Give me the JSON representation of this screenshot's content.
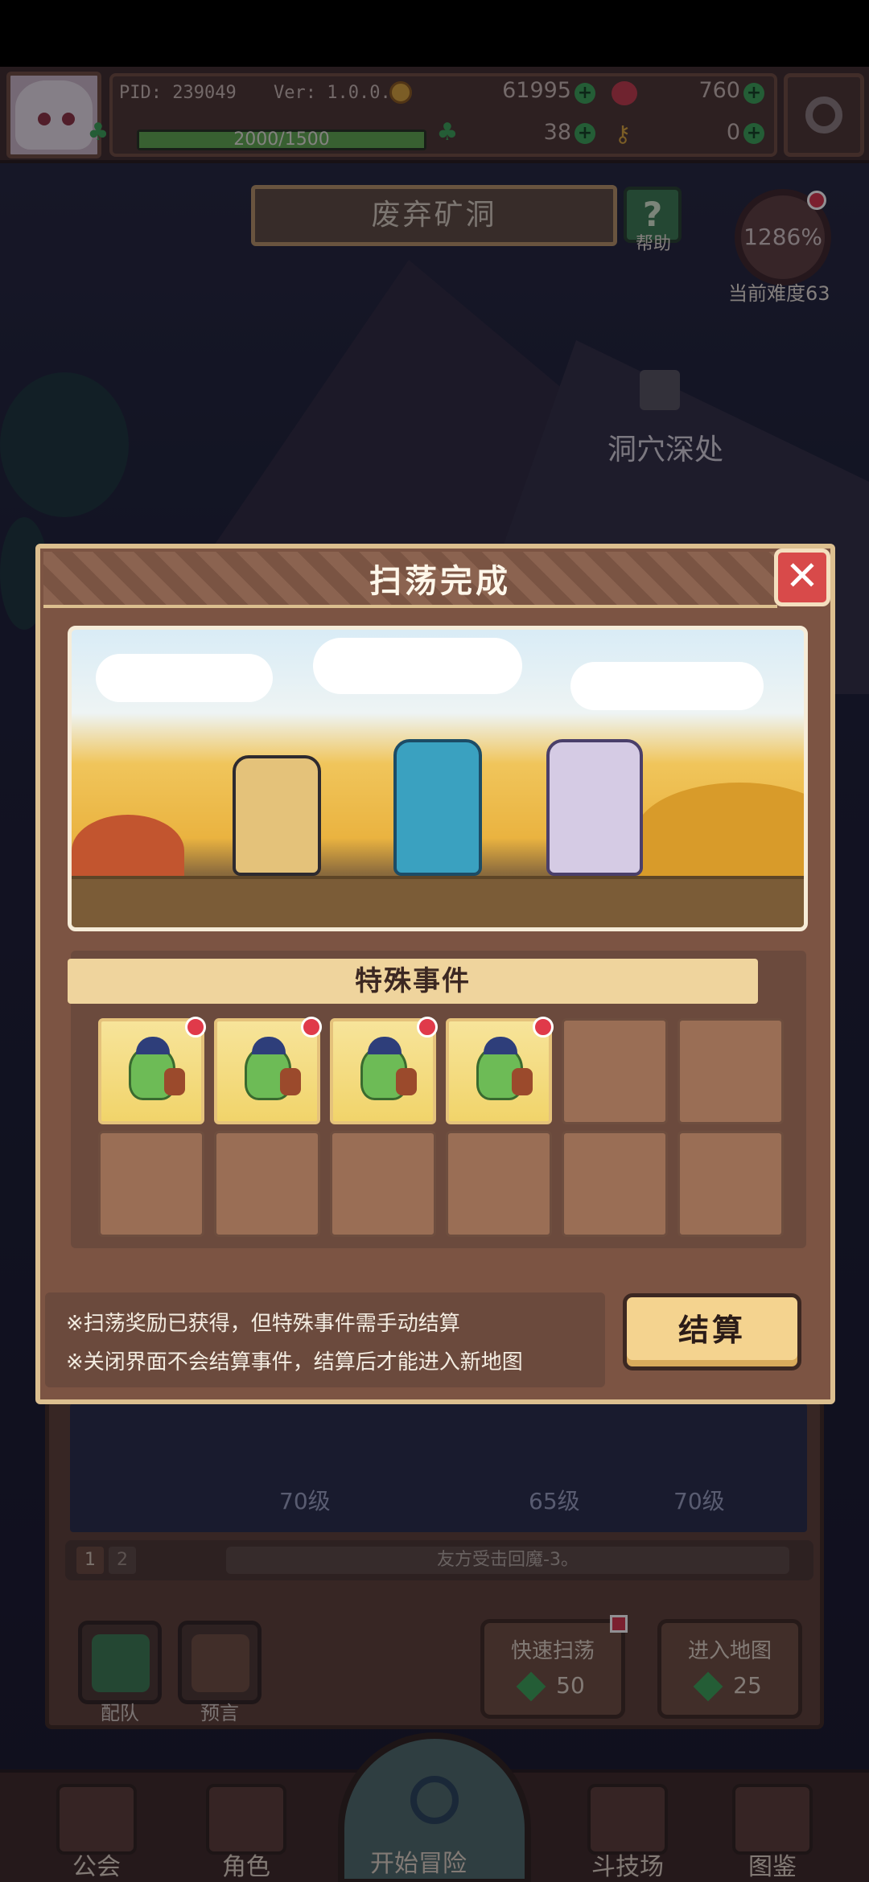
{
  "hud": {
    "pid": "PID: 239049",
    "version": "Ver: 1.0.0.8",
    "gold": "61995",
    "apples": "760",
    "exp": "2000/1500",
    "exp_fraction": 1.0,
    "clovers": "38",
    "keys": "0"
  },
  "map": {
    "name": "废弃矿洞",
    "help_label": "帮助",
    "difficulty_percent": "1286%",
    "difficulty_label": "当前难度63",
    "locked_area": "洞穴深处"
  },
  "modal": {
    "title": "扫荡完成",
    "close_symbol": "✕",
    "events_header": "特殊事件",
    "event_slots_filled": 4,
    "event_slots_total": 12,
    "note1": "※扫荡奖励已获得，但特殊事件需手动结算",
    "note2": "※关闭界面不会结算事件，结算后才能进入新地图",
    "settle_label": "结算"
  },
  "lower": {
    "lvl1": "70级",
    "lvl2": "65级",
    "lvl3": "70级",
    "page1": "1",
    "page2": "2",
    "log": "友方受击回魔-3。",
    "team_label": "配队",
    "prophecy_label": "预言",
    "quick_sweep_label": "快速扫荡",
    "quick_sweep_cost": "50",
    "enter_map_label": "进入地图",
    "enter_map_cost": "25"
  },
  "nav": {
    "guild": "公会",
    "character": "角色",
    "adventure": "开始冒险",
    "arena": "斗技场",
    "codex": "图鉴"
  },
  "colors": {
    "accent_gold": "#f4d38f",
    "close_red": "#d84a4a",
    "panel_brown": "#7c5443",
    "badge_red": "#e03a4a",
    "gem_green": "#3aa356"
  }
}
